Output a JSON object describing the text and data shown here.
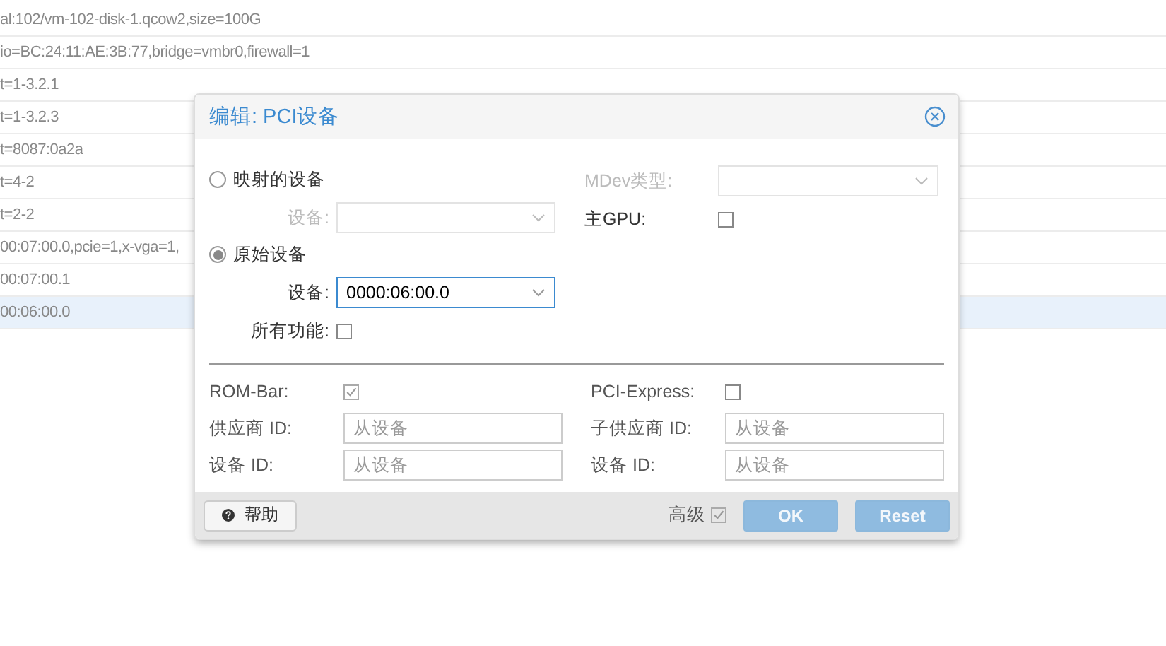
{
  "background_rows": [
    {
      "text": "al:102/vm-102-disk-1.qcow2,size=100G",
      "selected": false
    },
    {
      "text": "io=BC:24:11:AE:3B:77,bridge=vmbr0,firewall=1",
      "selected": false
    },
    {
      "text": "t=1-3.2.1",
      "selected": false
    },
    {
      "text": "t=1-3.2.3",
      "selected": false
    },
    {
      "text": "t=8087:0a2a",
      "selected": false
    },
    {
      "text": "t=4-2",
      "selected": false
    },
    {
      "text": "t=2-2",
      "selected": false
    },
    {
      "text": "00:07:00.0,pcie=1,x-vga=1,",
      "selected": false
    },
    {
      "text": "00:07:00.1",
      "selected": false
    },
    {
      "text": "00:06:00.0",
      "selected": true
    }
  ],
  "dialog": {
    "title": "编辑: PCI设备",
    "mapped": {
      "label": "映射的设备",
      "selected": false,
      "device_label": "设备:"
    },
    "mdev": {
      "label": "MDev类型:"
    },
    "primary_gpu": {
      "label": "主GPU:",
      "checked": false
    },
    "raw": {
      "label": "原始设备",
      "selected": true,
      "device_label": "设备:",
      "device_value": "0000:06:00.0"
    },
    "all_functions": {
      "label": "所有功能:",
      "checked": false
    },
    "rom_bar": {
      "label": "ROM-Bar:",
      "checked": true
    },
    "pcie": {
      "label": "PCI-Express:",
      "checked": false
    },
    "id_fields": [
      {
        "label": "供应商 ID:",
        "placeholder": "从设备"
      },
      {
        "label": "子供应商 ID:",
        "placeholder": "从设备"
      },
      {
        "label": "设备 ID:",
        "placeholder": "从设备"
      },
      {
        "label": "设备 ID:",
        "placeholder": "从设备"
      }
    ],
    "help_button": "帮助",
    "advanced": {
      "label": "高级",
      "checked": true
    },
    "buttons": [
      "OK",
      "Reset"
    ]
  }
}
